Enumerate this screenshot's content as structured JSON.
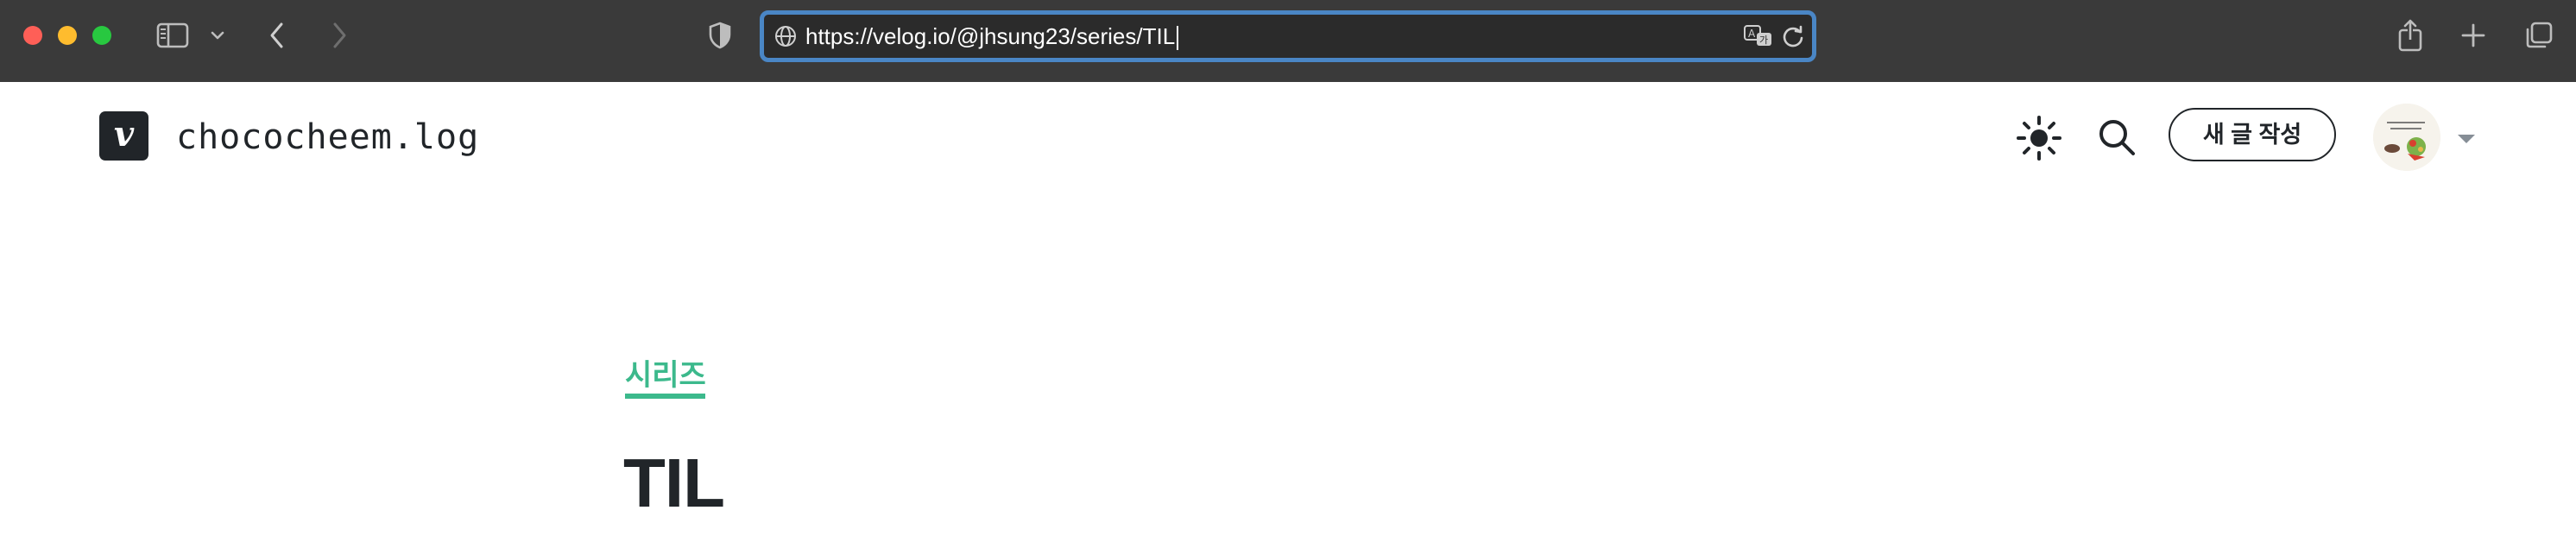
{
  "browser": {
    "url": "https://velog.io/@jhsung23/series/TIL"
  },
  "header": {
    "logo_letter": "v",
    "blog_title": "chococheem.log",
    "write_button": "새 글 작성"
  },
  "main": {
    "section_label": "시리즈",
    "series_title": "TIL"
  },
  "colors": {
    "accent": "#3cb98c",
    "text": "#212529",
    "toolbar": "#3a3a3a",
    "address_focus": "#4a86c5"
  },
  "icons": {
    "theme": "sun-icon",
    "search": "search-icon",
    "menu": "caret-down-icon"
  }
}
